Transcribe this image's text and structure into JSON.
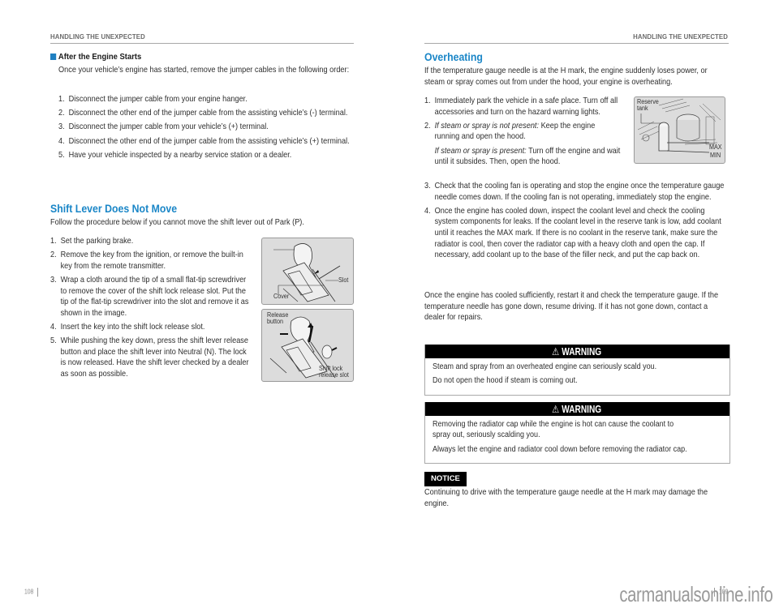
{
  "left_page": {
    "running_head": "HANDLING THE UNEXPECTED",
    "after_engine": {
      "title": "After the Engine Starts",
      "intro": "Once your vehicle’s engine has started, remove the jumper cables in the following order:",
      "steps": [
        {
          "num": "1.",
          "text": "Disconnect the jumper cable from your engine hanger."
        },
        {
          "num": "2.",
          "text": "Disconnect the other end of the jumper cable from the assisting vehicle’s (-) terminal."
        },
        {
          "num": "3.",
          "text": "Disconnect the jumper cable from your vehicle’s (+) terminal."
        },
        {
          "num": "4.",
          "text": "Disconnect the other end of the jumper cable from the assisting vehicle’s (+) terminal."
        },
        {
          "num": "5.",
          "text": "Have your vehicle inspected by a nearby service station or a dealer."
        }
      ]
    },
    "shift_lever": {
      "title": "Shift Lever Does Not Move",
      "intro": "Follow the procedure below if you cannot move the shift lever out of Park (P).",
      "steps": [
        {
          "num": "1.",
          "text": "Set the parking brake."
        },
        {
          "num": "2.",
          "text": "Remove the key from the ignition, or remove the built-in key from the remote transmitter."
        },
        {
          "num": "3.",
          "text": "Wrap a cloth around the tip of a small flat-tip screwdriver to remove the cover of the shift lock release slot. Put the tip of the flat-tip screwdriver into the slot and remove it as shown in the image."
        },
        {
          "num": "4.",
          "text": "Insert the key into the shift lock release slot."
        },
        {
          "num": "5.",
          "text": "While pushing the key down, press the shift lever release button and place the shift lever into Neutral (N). The lock is now released. Have the shift lever checked by a dealer as soon as possible."
        }
      ],
      "figure1_labels": {
        "slot": "Slot",
        "cover": "Cover"
      },
      "figure2_labels": {
        "release_button_1": "Release",
        "release_button_2": "button",
        "shift_lock_1": "Shift lock",
        "shift_lock_2": "release slot"
      }
    },
    "page_number": "108"
  },
  "right_page": {
    "running_head": "HANDLING THE UNEXPECTED",
    "overheating": {
      "title": "Overheating",
      "intro": "If the temperature gauge needle is at the H mark, the engine suddenly loses power, or steam or spray comes out from under the hood, your engine is overheating.",
      "steps": [
        {
          "num": "1.",
          "text": "Immediately park the vehicle in a safe place. Turn off all accessories and turn on the hazard warning lights."
        },
        {
          "num": "2.",
          "italic": "If steam or spray is not present:",
          "text": " Keep the engine running and open the hood.",
          "sub_italic": "If steam or spray is present:",
          "sub_text": " Turn off the engine and wait until it subsides. Then, open the hood."
        },
        {
          "num": "3.",
          "text": "Check that the cooling fan is operating and stop the engine once the temperature gauge needle comes down. If the cooling fan is not operating, immediately stop the engine."
        },
        {
          "num": "4.",
          "text": "Once the engine has cooled down, inspect the coolant level and check the cooling system components for leaks. If the coolant level in the reserve tank is low, add coolant until it reaches the MAX mark. If there is no coolant in the reserve tank, make sure the radiator is cool, then cover the radiator cap with a heavy cloth and open the cap. If necessary, add coolant up to the base of the filler neck, and put the cap back on."
        }
      ],
      "closing": "Once the engine has cooled sufficiently, restart it and check the temperature gauge. If the temperature needle has gone down, resume driving. If it has not gone down, contact a dealer for repairs.",
      "figure_labels": {
        "reserve_1": "Reserve",
        "reserve_2": "tank",
        "max": "MAX",
        "min": "MIN"
      }
    },
    "warnings": [
      {
        "label": "WARNING",
        "icon": "warning-triangle-icon",
        "lines": [
          "Steam and spray from an overheated engine can seriously scald you.",
          "Do not open the hood if steam is coming out."
        ]
      },
      {
        "label": "WARNING",
        "icon": "warning-triangle-icon",
        "lines": [
          "Removing the radiator cap while the engine is hot can cause the coolant to",
          "spray out, seriously scalding you.",
          "Always let the engine and radiator cool down before removing the radiator cap."
        ]
      }
    ],
    "notice": {
      "label": "NOTICE",
      "text": "Continuing to drive with the temperature gauge needle at the H mark may damage the engine."
    },
    "page_number": "109"
  },
  "watermark": "carmanualsonline.info",
  "colors": {
    "accent_blue": "#1a86c7",
    "square_blue": "#1f7fc1",
    "warning_black": "#000000"
  }
}
